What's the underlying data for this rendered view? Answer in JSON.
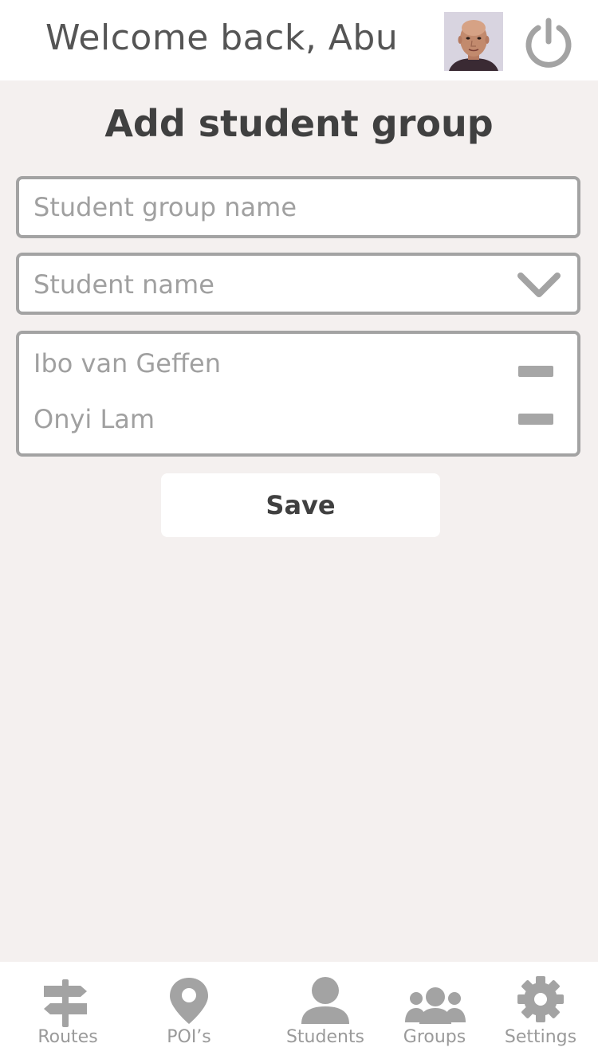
{
  "header": {
    "welcome_text": "Welcome back, Abu",
    "avatar_icon": "user-photo",
    "power_icon": "power-icon"
  },
  "page": {
    "title": "Add student group"
  },
  "form": {
    "group_name": {
      "placeholder": "Student group name",
      "value": ""
    },
    "student_select": {
      "selected_label": "Student name",
      "icon": "chevron-down-icon"
    },
    "students": [
      {
        "name": "Ibo van Geffen",
        "remove_icon": "minus-icon"
      },
      {
        "name": "Onyi Lam",
        "remove_icon": "minus-icon"
      }
    ],
    "save_label": "Save"
  },
  "nav": {
    "items": [
      {
        "label": "Routes",
        "icon": "signpost-icon"
      },
      {
        "label": "POI’s",
        "icon": "map-pin-icon"
      },
      {
        "label": "Students",
        "icon": "user-icon"
      },
      {
        "label": "Groups",
        "icon": "users-icon"
      },
      {
        "label": "Settings",
        "icon": "gear-icon"
      }
    ]
  },
  "colors": {
    "background": "#f4f0ef",
    "surface": "#ffffff",
    "border": "#a3a3a3",
    "icon": "#9a9a9a",
    "title_text": "#404040",
    "placeholder_text": "#a0a0a0"
  }
}
